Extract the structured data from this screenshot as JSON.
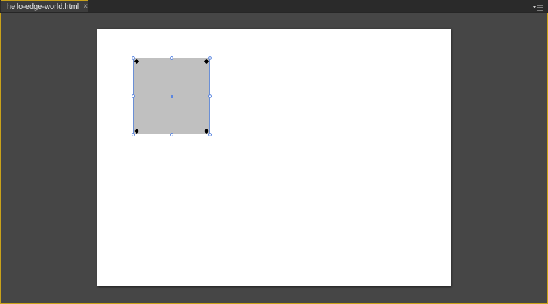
{
  "tabs": [
    {
      "label": "hello-edge-world.html",
      "close_icon": "close-icon",
      "active": true
    }
  ],
  "panel_menu_icon": "panel-menu-icon",
  "stage": {
    "background": "#ffffff",
    "rectangle": {
      "fill": "#c0c0c0",
      "selection_color": "#5b86e0",
      "selected": true
    }
  },
  "colors": {
    "workspace": "#464646",
    "accent": "#c9a21a"
  }
}
